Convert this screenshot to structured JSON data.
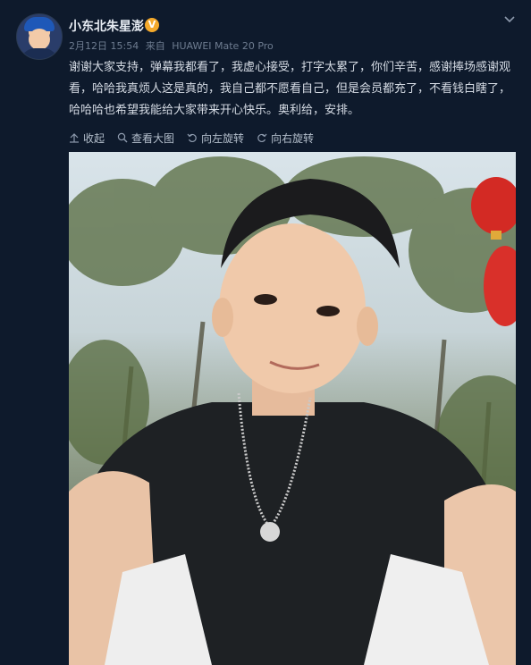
{
  "post": {
    "username": "小东北朱星澎",
    "verified_badge": "V",
    "date": "2月12日 15:54",
    "source_prefix": "来自",
    "source_device": "HUAWEI Mate 20 Pro",
    "content": "谢谢大家支持，弹幕我都看了，我虚心接受，打字太累了，你们辛苦，感谢捧场感谢观看，哈哈我真烦人这是真的，我自己都不愿看自己，但是会员都充了，不看钱白瞎了，哈哈哈也希望我能给大家带来开心快乐。奥利给，安排。"
  },
  "actions": {
    "collapse": "收起",
    "view_large": "查看大图",
    "rotate_left": "向左旋转",
    "rotate_right": "向右旋转"
  },
  "icons": {
    "menu": "chevron-down-icon",
    "collapse": "arrow-up-icon",
    "view_large": "magnifier-icon",
    "rotate_left": "rotate-left-icon",
    "rotate_right": "rotate-right-icon"
  },
  "colors": {
    "background": "#0e1a2c",
    "badge": "#f4a92b",
    "text": "#d5dbe4",
    "meta": "#6e7c90"
  }
}
